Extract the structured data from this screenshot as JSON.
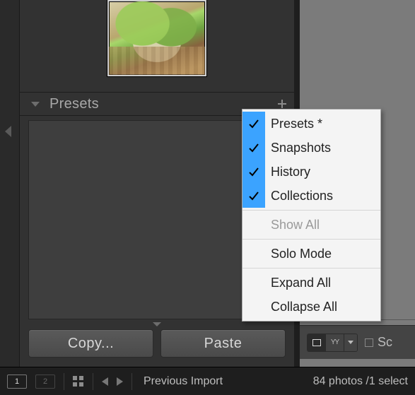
{
  "panel": {
    "title": "Presets"
  },
  "buttons": {
    "copy": "Copy...",
    "paste": "Paste"
  },
  "menu": {
    "items": [
      {
        "label": "Presets *",
        "checked": true,
        "enabled": true
      },
      {
        "label": "Snapshots",
        "checked": true,
        "enabled": true
      },
      {
        "label": "History",
        "checked": true,
        "enabled": true
      },
      {
        "label": "Collections",
        "checked": true,
        "enabled": true
      }
    ],
    "show_all": "Show All",
    "solo_mode": "Solo Mode",
    "expand_all": "Expand All",
    "collapse_all": "Collapse All"
  },
  "right_toolbar": {
    "sort_label_fragment": "Sc"
  },
  "bottom": {
    "page1": "1",
    "page2": "2",
    "source": "Previous Import",
    "count": "84 photos /1 select"
  }
}
